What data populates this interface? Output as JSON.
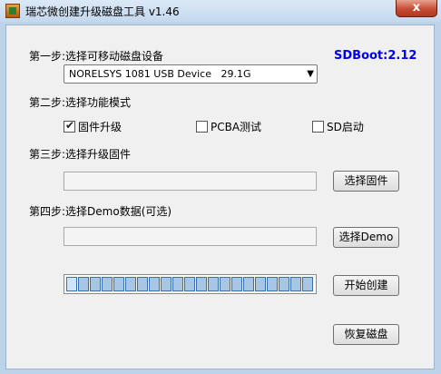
{
  "window": {
    "title": "瑞芯微创建升级磁盘工具 v1.46",
    "close_label": "x"
  },
  "step1": {
    "label": "第一步:选择可移动磁盘设备",
    "device_selected": "NORELSYS 1081 USB Device   29.1G",
    "sdboot": "SDBoot:2.12"
  },
  "step2": {
    "label": "第二步:选择功能模式",
    "options": [
      {
        "label": "固件升级",
        "checked": true
      },
      {
        "label": "PCBA测试",
        "checked": false
      },
      {
        "label": "SD启动",
        "checked": false
      }
    ]
  },
  "step3": {
    "label": "第三步:选择升级固件",
    "firmware_path": "",
    "button": "选择固件"
  },
  "step4": {
    "label": "第四步:选择Demo数据(可选)",
    "demo_path": "",
    "button": "选择Demo"
  },
  "progress": {
    "segments": 21,
    "active_segments": 1
  },
  "actions": {
    "create_button": "开始创建",
    "restore_button": "恢复磁盘"
  },
  "colors": {
    "titlebar": "#c4d8ee",
    "close": "#c44d35",
    "sdboot": "#0000ee",
    "progress_segment": "#a7c6e2"
  }
}
